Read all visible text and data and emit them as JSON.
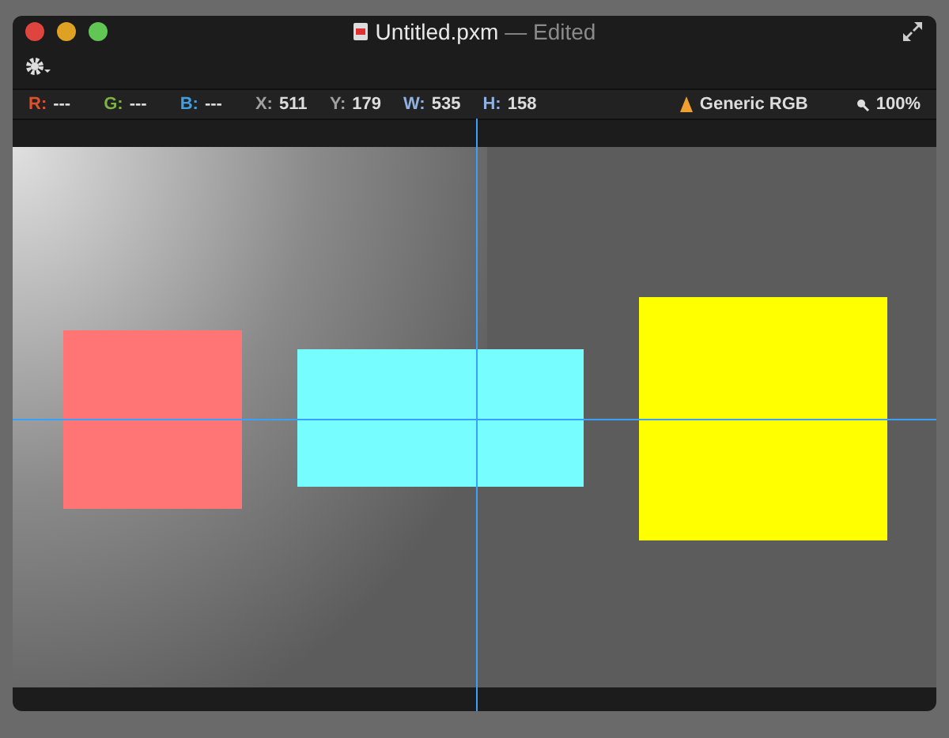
{
  "window": {
    "title": "Untitled.pxm",
    "status": "— Edited"
  },
  "readouts": [
    {
      "label": "R:",
      "value": "---",
      "color": "#e0502a"
    },
    {
      "label": "G:",
      "value": "---",
      "color": "#7cb342"
    },
    {
      "label": "B:",
      "value": "---",
      "color": "#3f9fe0"
    },
    {
      "label": "X:",
      "value": "511",
      "color": "#a0a0a0"
    },
    {
      "label": "Y:",
      "value": "179",
      "color": "#a0a0a0"
    },
    {
      "label": "W:",
      "value": "535",
      "color": "#8fb0e0"
    },
    {
      "label": "H:",
      "value": "158",
      "color": "#8fb0e0"
    }
  ],
  "color_profile": "Generic RGB",
  "zoom": "100%",
  "shapes": [
    {
      "kind": "rect",
      "color": "#ff7575"
    },
    {
      "kind": "rect",
      "color": "#75fdff"
    },
    {
      "kind": "rect",
      "color": "#ffff00"
    }
  ]
}
